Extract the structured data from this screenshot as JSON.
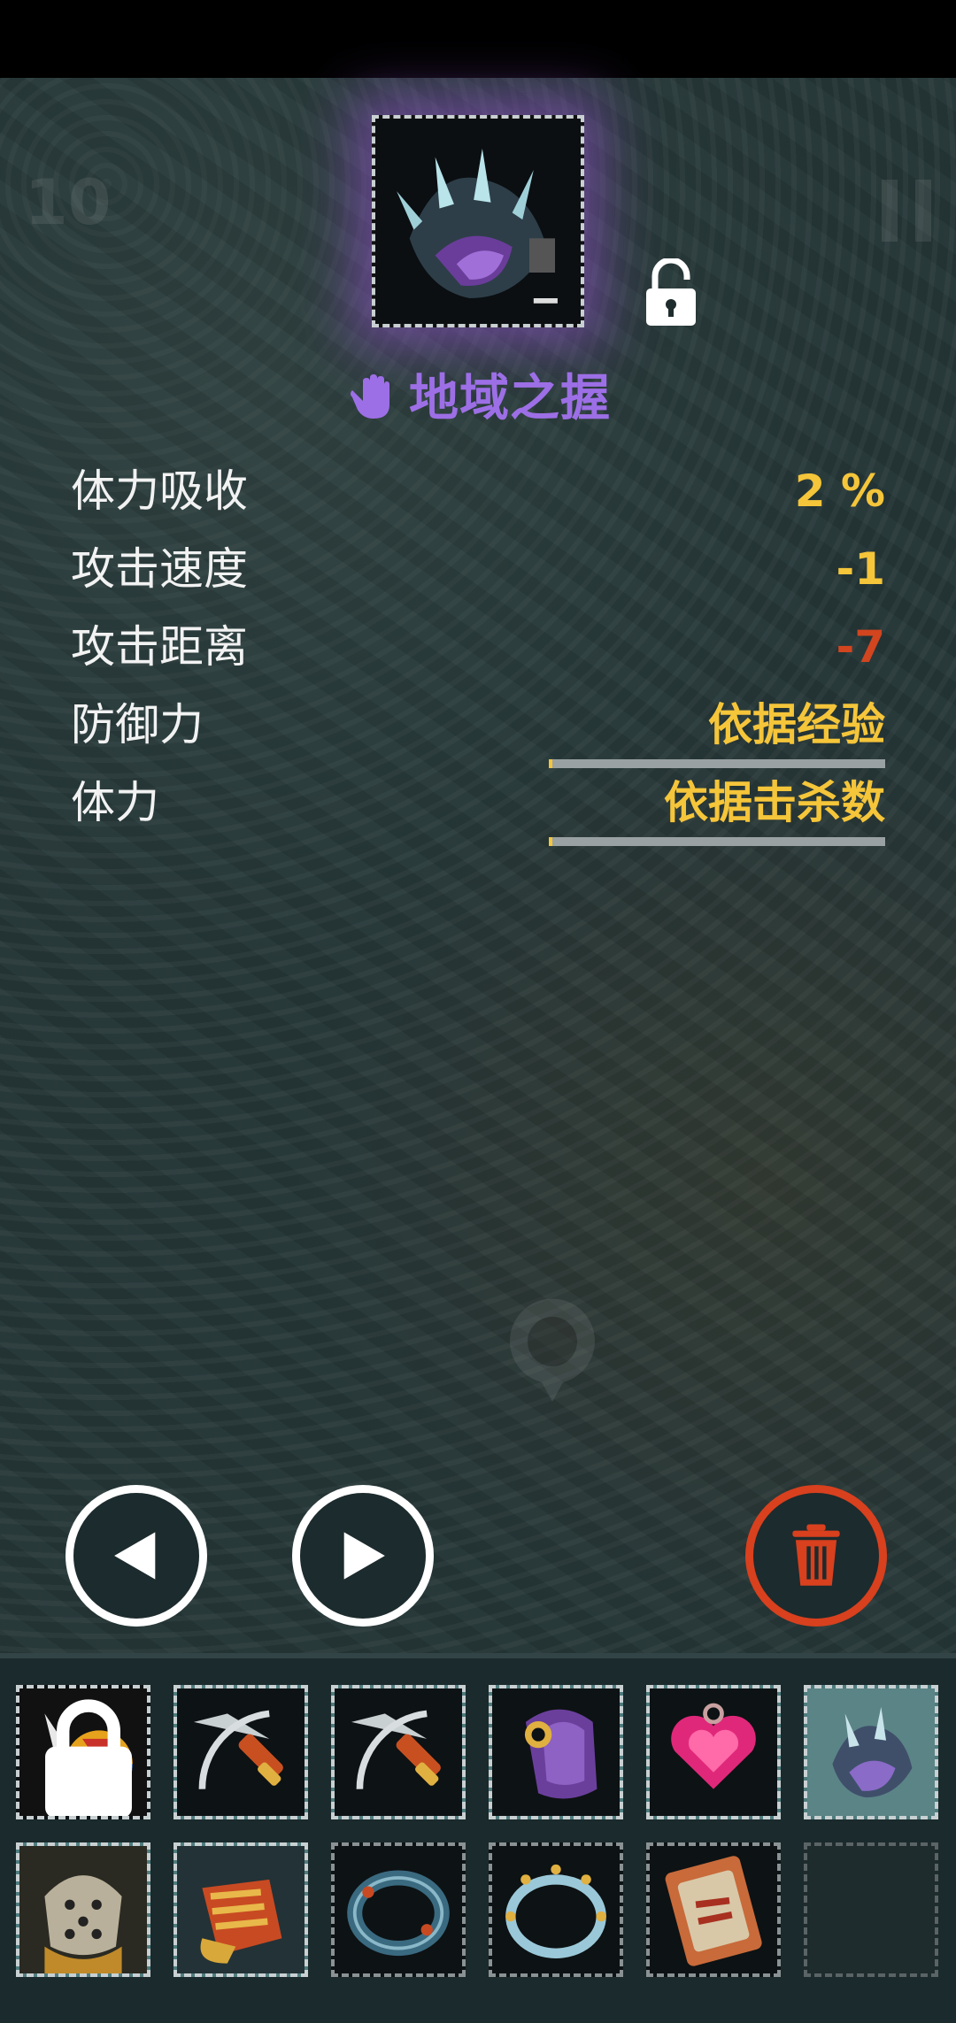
{
  "hud": {
    "level": "10"
  },
  "item": {
    "name": "地域之握",
    "name_color": "#9d6fe6",
    "icon": "claw-gauntlet-icon",
    "locked": false
  },
  "stats": [
    {
      "label": "体力吸收",
      "value": "2 %",
      "color": "yellow"
    },
    {
      "label": "攻击速度",
      "value": "-1",
      "color": "yellow"
    },
    {
      "label": "攻击距离",
      "value": "-7",
      "color": "red"
    },
    {
      "label": "防御力",
      "value": "依据经验",
      "color": "yellow",
      "progress": 0.01
    },
    {
      "label": "体力",
      "value": "依据击杀数",
      "color": "yellow",
      "progress": 0.01
    }
  ],
  "colors": {
    "accent_yellow": "#f5c53a",
    "accent_red": "#d2451f",
    "trash_red": "#d8401e",
    "rare_purple": "#9d6fe6"
  },
  "buttons": {
    "prev": "left-arrow-icon",
    "next": "right-arrow-icon",
    "delete": "trash-icon"
  },
  "inventory": [
    {
      "icon": "shield-banner-icon",
      "locked": true
    },
    {
      "icon": "crossbow-icon"
    },
    {
      "icon": "crossbow-icon"
    },
    {
      "icon": "purple-armor-icon"
    },
    {
      "icon": "heart-amulet-icon"
    },
    {
      "icon": "claw-gauntlet-icon",
      "selected": true
    },
    {
      "icon": "stone-helmet-icon"
    },
    {
      "icon": "fire-gauntlet-icon"
    },
    {
      "icon": "rune-ring-icon"
    },
    {
      "icon": "spiked-ring-icon"
    },
    {
      "icon": "rune-scroll-icon"
    },
    {
      "icon": "empty-slot"
    }
  ]
}
